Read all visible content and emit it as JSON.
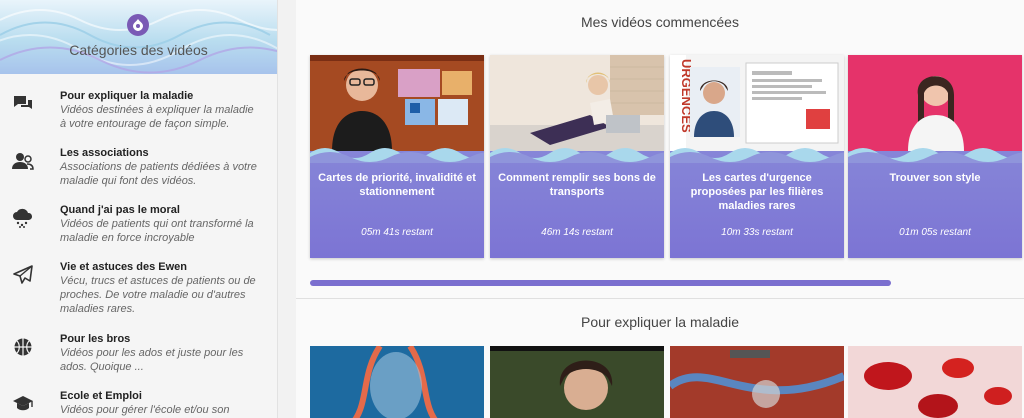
{
  "sidebar": {
    "title": "Catégories des vidéos",
    "categories": [
      {
        "icon": "chat-icon",
        "title": "Pour expliquer la maladie",
        "desc": "Vidéos destinées à expliquer la maladie à votre entourage de façon simple."
      },
      {
        "icon": "users-icon",
        "title": "Les associations",
        "desc": "Associations de patients dédiées à votre maladie qui font des vidéos."
      },
      {
        "icon": "storm-cloud-icon",
        "title": "Quand j'ai pas le moral",
        "desc": "Vidéos de patients qui ont transformé la maladie en force incroyable"
      },
      {
        "icon": "paper-plane-icon",
        "title": "Vie et astuces des Ewen",
        "desc": "Vécu, trucs et astuces de patients ou de proches. De votre maladie ou d'autres maladies rares."
      },
      {
        "icon": "basketball-icon",
        "title": "Pour les bros",
        "desc": "Vidéos pour les ados et juste pour les ados. Quoique ..."
      },
      {
        "icon": "graduation-cap-icon",
        "title": "Ecole et Emploi",
        "desc": "Vidéos pour gérer l'école et/ou son"
      }
    ]
  },
  "main": {
    "started_title": "Mes vidéos commencées",
    "started": [
      {
        "title": "Cartes de priorité, invalidité et stationnement",
        "remaining": "05m 41s restant"
      },
      {
        "title": "Comment remplir ses bons de transports",
        "remaining": "46m 14s restant"
      },
      {
        "title": "Les cartes d'urgence proposées par les filières maladies rares",
        "remaining": "10m 33s restant"
      },
      {
        "title": "Trouver son style",
        "remaining": "01m 05s restant"
      }
    ],
    "explain_title": "Pour expliquer la maladie",
    "thumb_text": {
      "urgences": "URGENCES"
    }
  },
  "colors": {
    "card_gradient_top": "#8f95db",
    "card_gradient_bottom": "#7c74d4",
    "progress": "#7b6fcf"
  }
}
